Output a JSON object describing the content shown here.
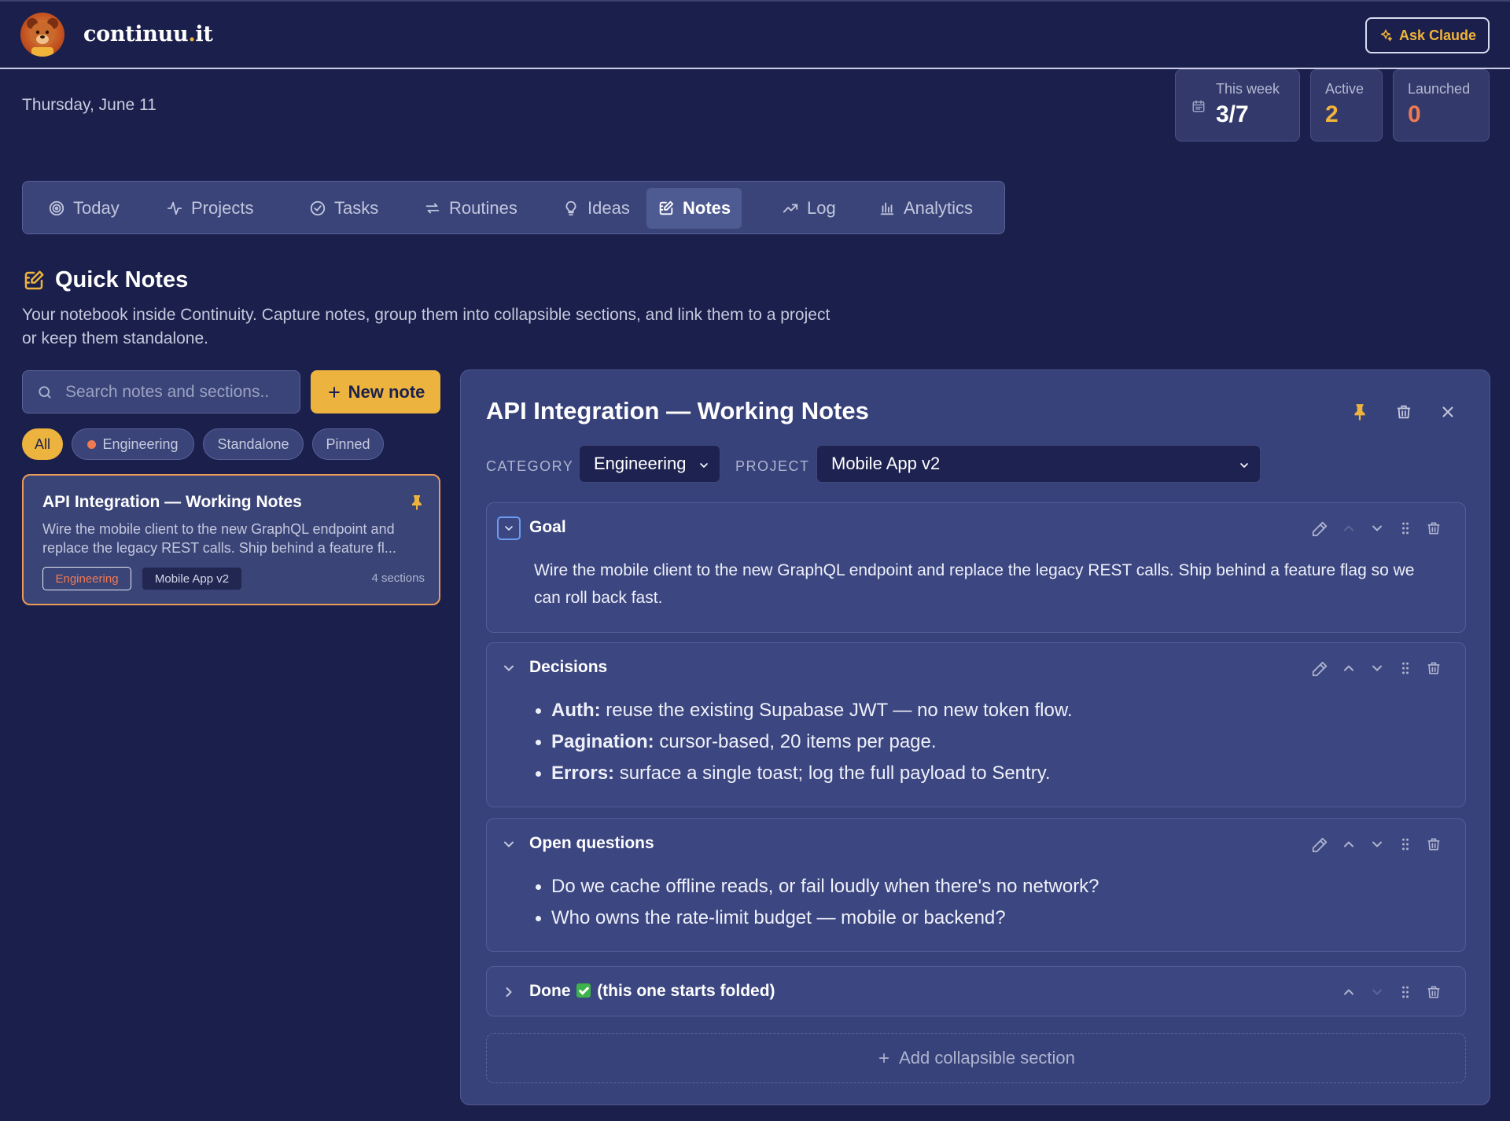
{
  "app": {
    "brand_name": "continuu",
    "brand_dot": ".",
    "brand_suffix": "it",
    "ask_label": "Ask Claude"
  },
  "date": "Thursday, June 11",
  "stats": [
    {
      "label": "This week",
      "value": "3/7",
      "color": "#ffffff"
    },
    {
      "label": "Active",
      "value": "2",
      "color": "#f0b43a"
    },
    {
      "label": "Launched",
      "value": "0",
      "color": "#ef7a52"
    }
  ],
  "nav": [
    {
      "label": "Today",
      "icon": "target-icon",
      "active": false
    },
    {
      "label": "Projects",
      "icon": "pulse-icon",
      "active": false
    },
    {
      "label": "Tasks",
      "icon": "check-circle-icon",
      "active": false
    },
    {
      "label": "Routines",
      "icon": "repeat-icon",
      "active": false
    },
    {
      "label": "Ideas",
      "icon": "lightbulb-icon",
      "active": false
    },
    {
      "label": "Notes",
      "icon": "edit-note-icon",
      "active": true
    },
    {
      "label": "Log",
      "icon": "trending-icon",
      "active": false
    },
    {
      "label": "Analytics",
      "icon": "bar-chart-icon",
      "active": false
    }
  ],
  "quick_notes": {
    "title": "Quick Notes",
    "description": "Your notebook inside Continuity. Capture notes, group them into collapsible sections, and link them to a project or keep them standalone."
  },
  "search": {
    "placeholder": "Search notes and sections..",
    "value": ""
  },
  "new_note_label": "New note",
  "filters": [
    {
      "label": "All",
      "active": true
    },
    {
      "label": "Engineering",
      "active": false,
      "dot_color": "#ef7a52"
    },
    {
      "label": "Standalone",
      "active": false
    },
    {
      "label": "Pinned",
      "active": false
    }
  ],
  "note_card": {
    "title": "API Integration — Working Notes",
    "excerpt": "Wire the mobile client to the new GraphQL endpoint and replace the legacy REST calls. Ship behind a feature fl...",
    "category_tag": "Engineering",
    "project_tag": "Mobile App v2",
    "sections_count": "4 sections"
  },
  "detail": {
    "title": "API Integration — Working Notes",
    "category_label": "CATEGORY",
    "category_value": "Engineering",
    "project_label": "PROJECT",
    "project_value": "Mobile App v2",
    "sections": [
      {
        "title": "Goal",
        "expanded": true,
        "body": "Wire the mobile client to the new GraphQL endpoint and replace the legacy REST calls. Ship behind a feature flag so we can roll back fast."
      },
      {
        "title": "Decisions",
        "expanded": true,
        "items": [
          {
            "label": "Auth:",
            "text": " reuse the existing Supabase JWT — no new token flow."
          },
          {
            "label": "Pagination:",
            "text": " cursor-based, 20 items per page."
          },
          {
            "label": "Errors:",
            "text": " surface a single toast; log the full payload to Sentry."
          }
        ]
      },
      {
        "title": "Open questions",
        "expanded": true,
        "items": [
          {
            "text": "Do we cache offline reads, or fail loudly when there's no network?"
          },
          {
            "text": "Who owns the rate-limit budget — mobile or backend?"
          }
        ]
      },
      {
        "title_prefix": "Done",
        "title_suffix": "(this one starts folded)",
        "expanded": false
      }
    ],
    "add_section_label": "Add collapsible section"
  },
  "colors": {
    "background": "#1b1f4b",
    "accent": "#ecb43e",
    "engineering": "#ef7a52"
  }
}
